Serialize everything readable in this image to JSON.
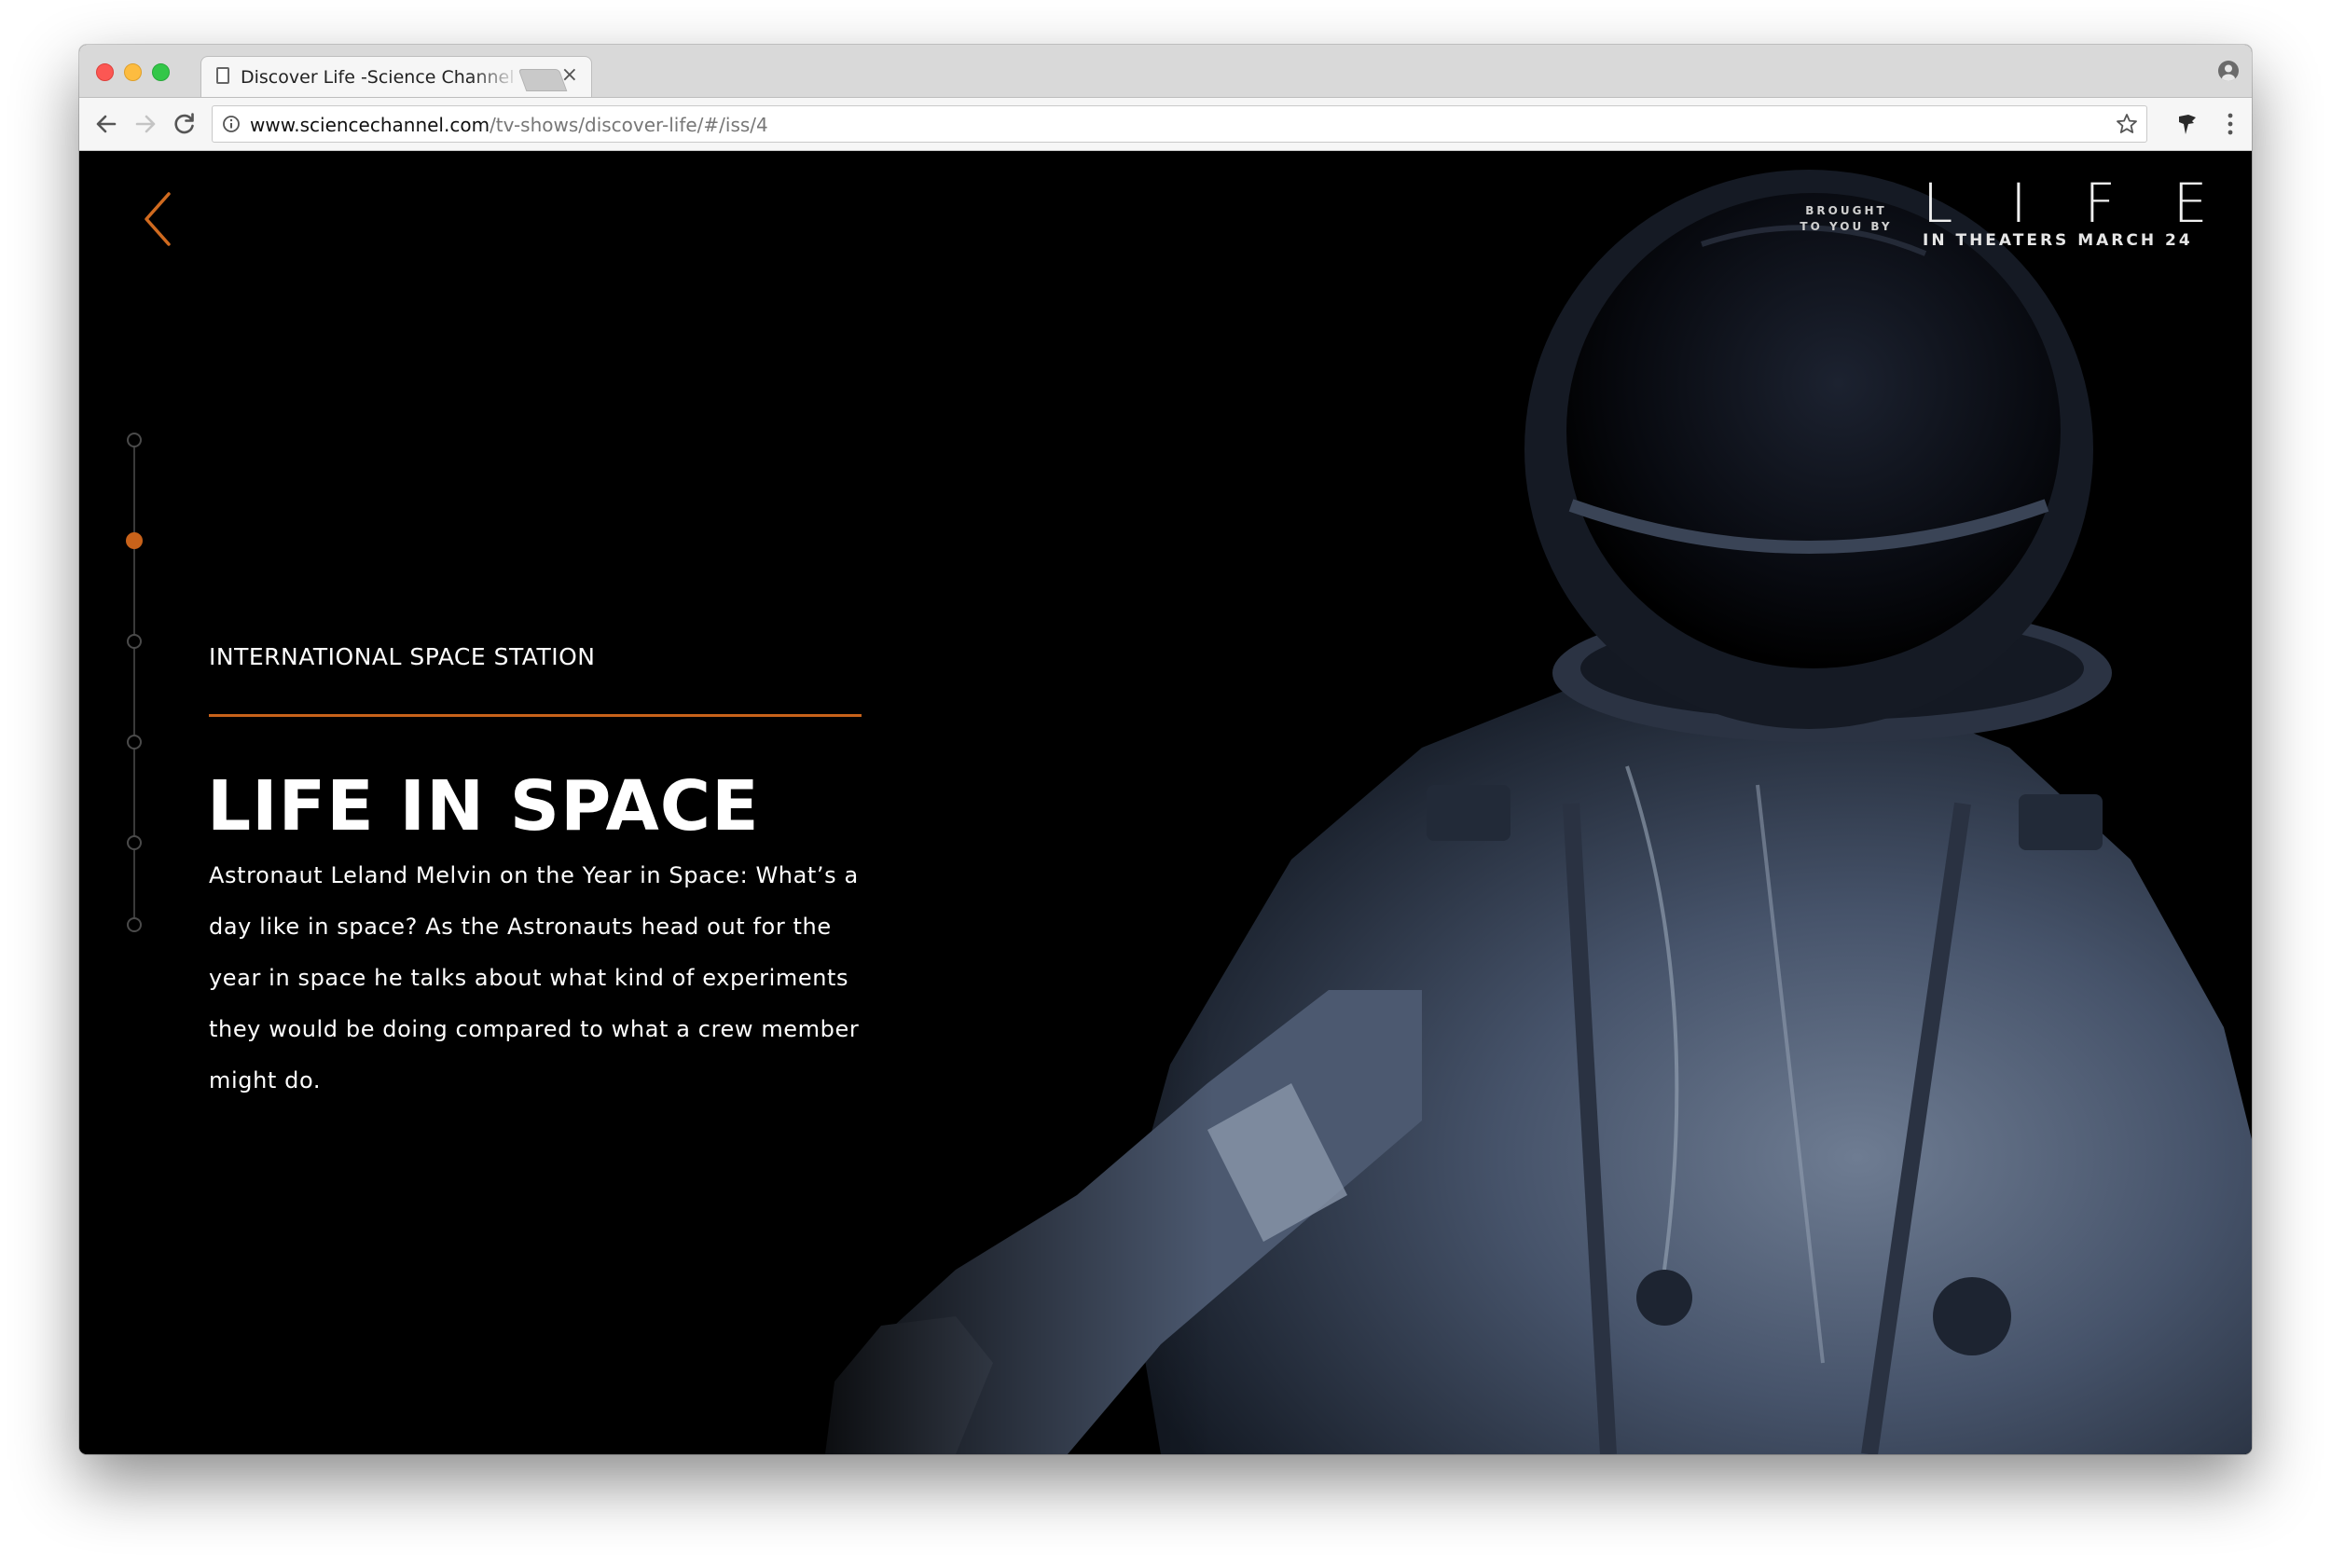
{
  "browser": {
    "tab_title": "Discover Life -Science Channel",
    "tab_close": "×",
    "url_host": "www.sciencechannel.com",
    "url_path": "/tv-shows/discover-life/#/iss/4"
  },
  "page": {
    "section_label": "INTERNATIONAL SPACE STATION",
    "headline": "LIFE IN SPACE",
    "body": "Astronaut Leland Melvin on the Year in Space: What’s a day like in space? As the Astronauts head out for the year in space he talks about what kind of experiments they would be doing compared to what a crew member might do.",
    "timeline": {
      "total_steps": 6,
      "active_step": 2
    }
  },
  "promo": {
    "brought_line1": "BROUGHT",
    "brought_line2": "TO YOU BY",
    "title": "LIFE",
    "subtitle": "IN THEATERS MARCH 24"
  },
  "colors": {
    "accent": "#c8621a",
    "traffic_close": "#fc5753",
    "traffic_minimize": "#fdbc40",
    "traffic_zoom": "#33c748"
  },
  "icons": {
    "back": "chevron-left-icon",
    "forward": "chevron-right-icon",
    "reload": "reload-icon",
    "info": "info-icon",
    "bookmark": "star-icon",
    "extension": "extension-icon",
    "menu": "kebab-menu-icon",
    "profile": "profile-icon"
  }
}
